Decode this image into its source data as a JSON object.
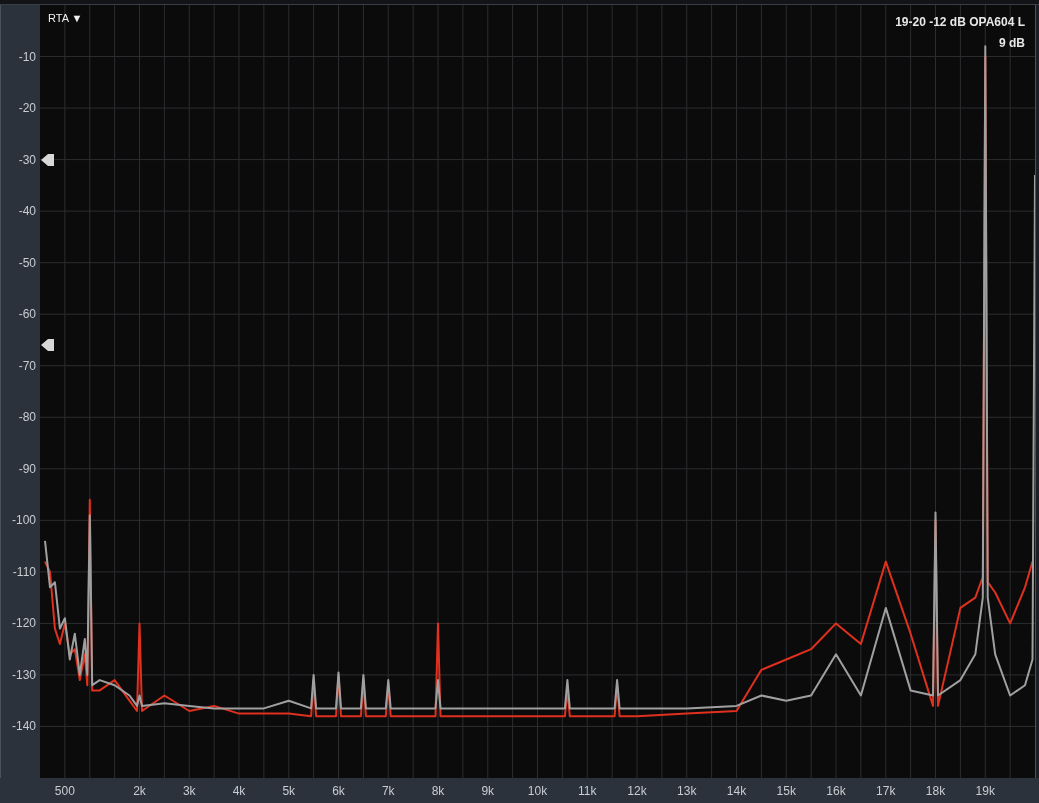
{
  "mode_menu": {
    "label": "RTA",
    "caret": "▼"
  },
  "trace_title": "19-20 -12 dB OPA604 L",
  "readout": "9 dB",
  "chart_data": {
    "type": "line",
    "grid": true,
    "xlim": [
      0,
      20000
    ],
    "ylim": [
      -150,
      0
    ],
    "yticks": [
      -10,
      -20,
      -30,
      -40,
      -50,
      -60,
      -70,
      -80,
      -90,
      -100,
      -110,
      -120,
      -130,
      -140
    ],
    "xticks": [
      {
        "value": 500,
        "label": "500"
      },
      {
        "value": 2000,
        "label": "2k"
      },
      {
        "value": 3000,
        "label": "3k"
      },
      {
        "value": 4000,
        "label": "4k"
      },
      {
        "value": 5000,
        "label": "5k"
      },
      {
        "value": 6000,
        "label": "6k"
      },
      {
        "value": 7000,
        "label": "7k"
      },
      {
        "value": 8000,
        "label": "8k"
      },
      {
        "value": 9000,
        "label": "9k"
      },
      {
        "value": 10000,
        "label": "10k"
      },
      {
        "value": 11000,
        "label": "11k"
      },
      {
        "value": 12000,
        "label": "12k"
      },
      {
        "value": 13000,
        "label": "13k"
      },
      {
        "value": 14000,
        "label": "14k"
      },
      {
        "value": 15000,
        "label": "15k"
      },
      {
        "value": 16000,
        "label": "16k"
      },
      {
        "value": 17000,
        "label": "17k"
      },
      {
        "value": 18000,
        "label": "18k"
      },
      {
        "value": 19000,
        "label": "19k"
      }
    ],
    "x": [
      100,
      200,
      300,
      400,
      500,
      600,
      700,
      800,
      900,
      950,
      1000,
      1050,
      1200,
      1500,
      1800,
      1950,
      2000,
      2050,
      2500,
      3000,
      3500,
      4000,
      4500,
      5000,
      5450,
      5500,
      5550,
      5950,
      6000,
      6050,
      6450,
      6500,
      6550,
      6950,
      7000,
      7050,
      7500,
      7950,
      8000,
      8050,
      9000,
      10000,
      10550,
      10600,
      10650,
      11000,
      11550,
      11600,
      11650,
      12000,
      13000,
      14000,
      14500,
      15000,
      15500,
      16000,
      16500,
      17000,
      17500,
      17950,
      18000,
      18050,
      18500,
      18800,
      18950,
      19000,
      19050,
      19200,
      19500,
      19800,
      19950,
      20000
    ],
    "series": [
      {
        "color": "#e0301e",
        "values": [
          -108,
          -110,
          -121,
          -124,
          -120,
          -126,
          -125,
          -131,
          -126,
          -132,
          -96,
          -133,
          -133,
          -131,
          -135,
          -137,
          -120,
          -137,
          -134,
          -137,
          -136,
          -137.5,
          -137.5,
          -137.5,
          -138,
          -131,
          -138,
          -138,
          -130,
          -138,
          -138,
          -131,
          -138,
          -138,
          -132,
          -138,
          -138,
          -138,
          -120,
          -138,
          -138,
          -138,
          -138,
          -133,
          -138,
          -138,
          -138,
          -132,
          -138,
          -138,
          -137.5,
          -137,
          -129,
          -127,
          -125,
          -120,
          -124,
          -108,
          -122,
          -136,
          -100,
          -136,
          -117,
          -115,
          -111,
          -10,
          -112,
          -114,
          -120,
          -113,
          -108,
          null
        ]
      },
      {
        "color": "#a0a0a0",
        "values": [
          -104,
          -113,
          -112,
          -121,
          -119,
          -127,
          -122,
          -130,
          -123,
          -130,
          -99,
          -132,
          -131,
          -132,
          -134,
          -136,
          -134,
          -136,
          -135.5,
          -136,
          -136.5,
          -136.5,
          -136.5,
          -135,
          -136.5,
          -130,
          -136.5,
          -136.5,
          -129.5,
          -136.5,
          -136.5,
          -130,
          -136.5,
          -136.5,
          -131,
          -136.5,
          -136.5,
          -136.5,
          -131,
          -136.5,
          -136.5,
          -136.5,
          -136.5,
          -131,
          -136.5,
          -136.5,
          -136.5,
          -131,
          -136.5,
          -136.5,
          -136.5,
          -136,
          -134,
          -135,
          -134,
          -126,
          -134,
          -117,
          -133,
          -134,
          -98.5,
          -134,
          -131,
          -126,
          -115,
          -8,
          -115,
          -126,
          -134,
          -132,
          -127,
          -33
        ]
      }
    ]
  }
}
